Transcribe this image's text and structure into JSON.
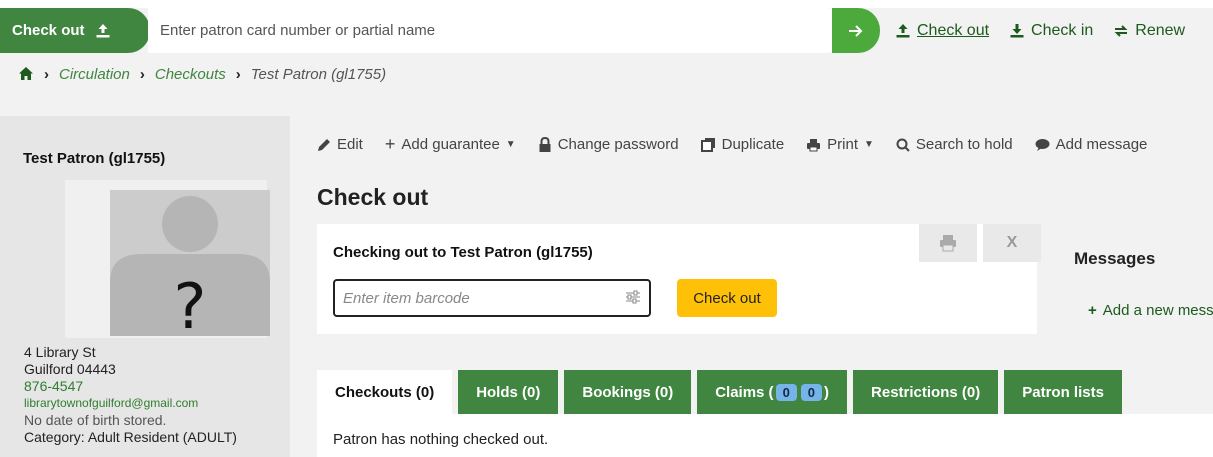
{
  "header": {
    "checkout_tab_label": "Check out",
    "search_placeholder": "Enter patron card number or partial name",
    "links": [
      {
        "label": "Check out",
        "icon": "upload-icon"
      },
      {
        "label": "Check in",
        "icon": "download-icon"
      },
      {
        "label": "Renew",
        "icon": "renew-icon"
      }
    ]
  },
  "breadcrumb": {
    "items": [
      "Circulation",
      "Checkouts"
    ],
    "current": "Test Patron (gl1755)"
  },
  "patron": {
    "name": "Test Patron (gl1755)",
    "photo_placeholder": "?",
    "address_line1": "4 Library St",
    "address_line2": "Guilford 04443",
    "phone": "876-4547",
    "email": "librarytownofguilford@gmail.com",
    "dob": "No date of birth stored.",
    "category": "Category: Adult Resident (ADULT)"
  },
  "toolbar": {
    "edit": "Edit",
    "add_guarantee": "Add guarantee",
    "change_password": "Change password",
    "duplicate": "Duplicate",
    "print": "Print",
    "search_to_hold": "Search to hold",
    "add_message": "Add message"
  },
  "page_title": "Check out",
  "checkout_box": {
    "heading": "Checking out to Test Patron (gl1755)",
    "barcode_placeholder": "Enter item barcode",
    "submit_label": "Check out"
  },
  "messages": {
    "title": "Messages",
    "add_label": "Add a new message"
  },
  "tabs": [
    {
      "label": "Checkouts (0)"
    },
    {
      "label": "Holds (0)"
    },
    {
      "label": "Bookings (0)"
    },
    {
      "label_prefix": "Claims (",
      "badge1": "0",
      "badge2": "0",
      "label_suffix": ")"
    },
    {
      "label": "Restrictions (0)"
    },
    {
      "label": "Patron lists"
    }
  ],
  "tab_content": "Patron has nothing checked out.",
  "colors": {
    "brand_green": "#408540",
    "search_green": "#4caa3c",
    "warning_yellow": "#ffc107",
    "badge_blue": "#76b3e8"
  }
}
